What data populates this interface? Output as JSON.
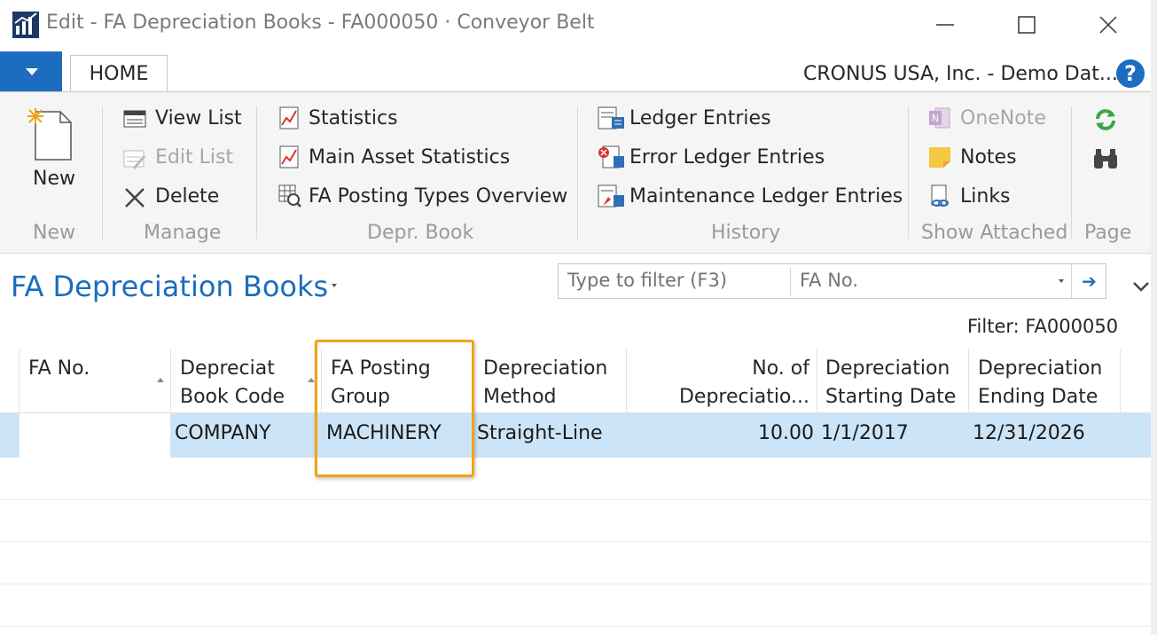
{
  "window": {
    "title": "Edit - FA Depreciation Books - FA000050 · Conveyor Belt"
  },
  "ribbon_tabs": {
    "home": "HOME",
    "company": "CRONUS USA, Inc. - Demo Dat...",
    "help": "?"
  },
  "ribbon": {
    "new_group": {
      "new": "New",
      "label": "New"
    },
    "manage_group": {
      "view_list": "View List",
      "edit_list": "Edit List",
      "delete": "Delete",
      "label": "Manage"
    },
    "depr_group": {
      "statistics": "Statistics",
      "main_asset_statistics": "Main Asset Statistics",
      "posting_types_overview": "FA Posting Types Overview",
      "label": "Depr. Book"
    },
    "history_group": {
      "ledger_entries": "Ledger Entries",
      "error_ledger_entries": "Error Ledger Entries",
      "maintenance_ledger_entries": "Maintenance Ledger Entries",
      "label": "History"
    },
    "attached_group": {
      "onenote": "OneNote",
      "notes": "Notes",
      "links": "Links",
      "label": "Show Attached"
    },
    "page_group": {
      "label": "Page"
    }
  },
  "page": {
    "title": "FA Depreciation Books",
    "filter_placeholder": "Type to filter (F3)",
    "filter_field": "FA No.",
    "filter_status": "Filter: FA000050"
  },
  "columns": [
    {
      "label": "FA No."
    },
    {
      "label": "Depreciat Book Code"
    },
    {
      "label": "FA Posting Group"
    },
    {
      "label": "Depreciation Method"
    },
    {
      "label": "No. of Depreciatio..."
    },
    {
      "label": "Depreciation Starting Date"
    },
    {
      "label": "Depreciation Ending Date"
    }
  ],
  "rows": [
    {
      "fa_no": "",
      "book_code": "COMPANY",
      "posting_group": "MACHINERY",
      "method": "Straight-Line",
      "no_of_years": "10.00",
      "starting_date": "1/1/2017",
      "ending_date": "12/31/2026"
    }
  ],
  "colors": {
    "accent": "#1c6dbf",
    "selected_row": "#cce4f7",
    "highlight": "#f0a318"
  }
}
